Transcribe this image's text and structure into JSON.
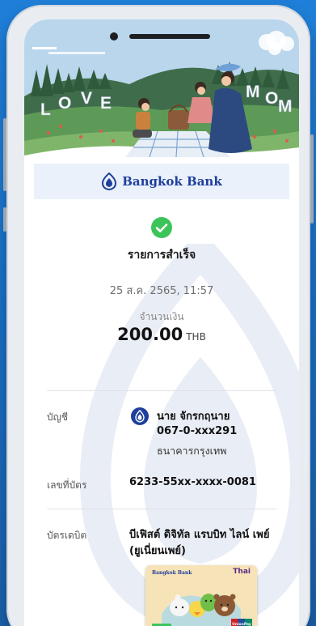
{
  "banner": {
    "left_word": [
      "L",
      "O",
      "V",
      "E"
    ],
    "right_word": [
      "M",
      "O",
      "M"
    ]
  },
  "header": {
    "bank_name": "Bangkok Bank"
  },
  "transaction": {
    "status": "รายการสำเร็จ",
    "datetime": "25 ส.ค. 2565, 11:57",
    "amount_label": "จำนวนเงิน",
    "amount": "200.00",
    "currency": "THB"
  },
  "account": {
    "label": "บัญชี",
    "name": "นาย จักรกฤนาย",
    "number": "067-0-xxx291",
    "bank": "ธนาคารกรุงเทพ"
  },
  "card": {
    "label": "เลขที่บัตร",
    "number": "6233-55xx-xxxx-0081"
  },
  "debit": {
    "label": "บัตรเดบิต",
    "type": "บีเฟิสต์ ดิจิทัล แรบบิท ไลน์ เพย์ (ยูเนี่ยนเพย์)",
    "card_brand": "Bangkok Bank",
    "card_partner": "Thai",
    "card_network": "UnionPay"
  },
  "colors": {
    "brand_blue": "#1e3f9c",
    "success_green": "#3cc45a",
    "background_blue": "#1f7fd8"
  }
}
